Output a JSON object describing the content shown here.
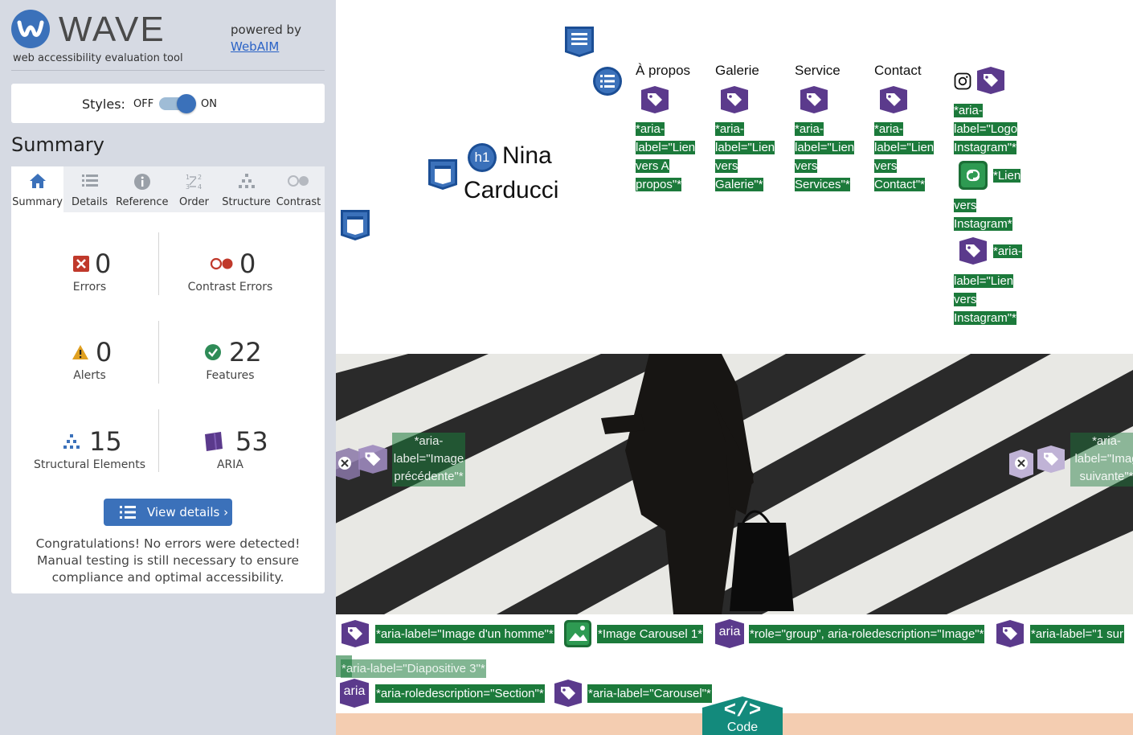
{
  "sidebar": {
    "app_name": "WAVE",
    "subtitle": "web accessibility evaluation tool",
    "powered_by": "powered by",
    "powered_link": "WebAIM",
    "styles_label": "Styles:",
    "styles_off": "OFF",
    "styles_on": "ON",
    "styles_state": "on",
    "summary_heading": "Summary",
    "tabs": [
      {
        "label": "Summary",
        "icon": "home-icon",
        "active": true
      },
      {
        "label": "Details",
        "icon": "list-icon",
        "active": false
      },
      {
        "label": "Reference",
        "icon": "info-icon",
        "active": false
      },
      {
        "label": "Order",
        "icon": "order-icon",
        "active": false
      },
      {
        "label": "Structure",
        "icon": "structure-icon",
        "active": false
      },
      {
        "label": "Contrast",
        "icon": "contrast-icon",
        "active": false
      }
    ],
    "stats": {
      "errors": {
        "count": "0",
        "label": "Errors",
        "color": "#c0392b"
      },
      "contrast_errors": {
        "count": "0",
        "label": "Contrast Errors",
        "color": "#c0392b"
      },
      "alerts": {
        "count": "0",
        "label": "Alerts",
        "color": "#e0a020"
      },
      "features": {
        "count": "22",
        "label": "Features",
        "color": "#2e8b57"
      },
      "structural": {
        "count": "15",
        "label": "Structural Elements",
        "color": "#3b71ba"
      },
      "aria": {
        "count": "53",
        "label": "ARIA",
        "color": "#5b3a8c"
      }
    },
    "view_details": "View details ›",
    "congrats": "Congratulations! No errors were detected! Manual testing is still necessary to ensure compliance and optimal accessibility."
  },
  "page": {
    "nav": [
      {
        "text": "À propos",
        "aria": "*aria-\nlabel=\"Lien\nvers A\npropos\"*"
      },
      {
        "text": "Galerie",
        "aria": "*aria-\nlabel=\"Lien\nvers\nGalerie\"*"
      },
      {
        "text": "Service",
        "aria": "*aria-\nlabel=\"Lien\nvers\nServices\"*"
      },
      {
        "text": "Contact",
        "aria": "*aria-\nlabel=\"Lien\nvers\nContact\"*"
      }
    ],
    "instagram_logo_label": "*aria-\nlabel=\"Logo\nInstagram\"*",
    "instagram_link_label": "*Lien",
    "instagram_link_label2": "vers\nInstagram*",
    "instagram_aria_label": "*aria-",
    "instagram_aria_label2": "label=\"Lien\nvers\nInstagram\"*",
    "h1_badge": "h1",
    "h1_line1": "Nina",
    "h1_line2": "Carducci",
    "prev_label": "*aria-\nlabel=\"Image\nprécédente\"*",
    "next_label": "*aria-\nlabel=\"Imag\nsuivante\"*",
    "row1": [
      "*aria-label=\"Image d'un homme\"*",
      "*Image Carousel 1*",
      "*role=\"group\", aria-roledescription=\"Image\"*",
      "*aria-label=\"1 sur"
    ],
    "aria_text": "aria",
    "slide_label": "*aria-label=\"Diapositive 3\"*",
    "row3": [
      "*aria-roledescription=\"Section\"*",
      "*aria-label=\"Carousel\"*"
    ],
    "code_label": "Code",
    "code_symbol": "</>"
  }
}
